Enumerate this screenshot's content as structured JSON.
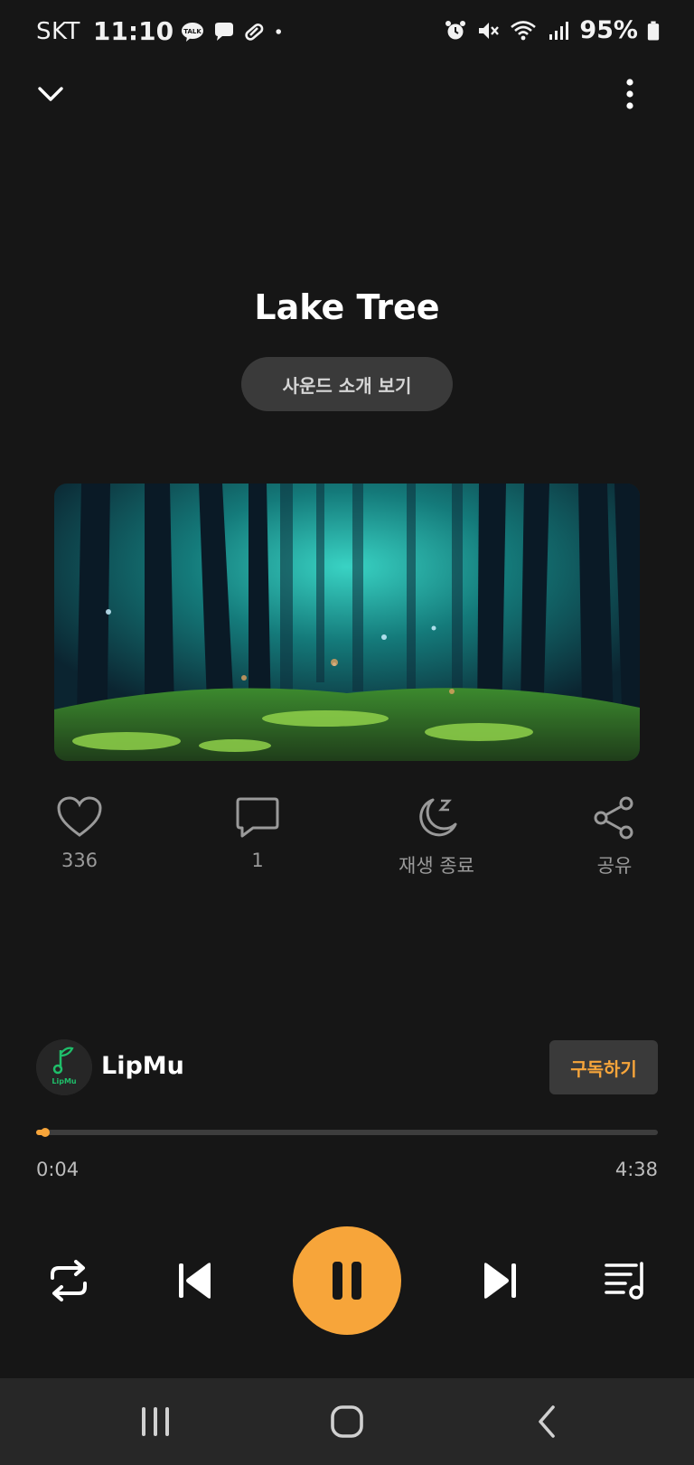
{
  "status_bar": {
    "carrier": "SKT",
    "time": "11:10",
    "battery": "95%",
    "left_icons": [
      "talk-icon",
      "chat-bubble-icon",
      "link-icon",
      "dot-icon"
    ],
    "right_icons": [
      "alarm-icon",
      "mute-icon",
      "wifi-icon",
      "signal-icon",
      "battery-icon"
    ]
  },
  "track": {
    "title": "Lake Tree",
    "intro_button": "사운드 소개 보기"
  },
  "actions": {
    "like_count": "336",
    "comment_count": "1",
    "sleep_timer_label": "재생 종료",
    "share_label": "공유"
  },
  "channel": {
    "name": "LipMu",
    "avatar_text": "LipMu",
    "subscribe_label": "구독하기"
  },
  "player": {
    "current_time": "0:04",
    "total_time": "4:38",
    "progress": 0.015,
    "state": "playing"
  },
  "colors": {
    "background": "#161616",
    "accent": "#f7a53a",
    "brand_green": "#1fbf6a"
  }
}
